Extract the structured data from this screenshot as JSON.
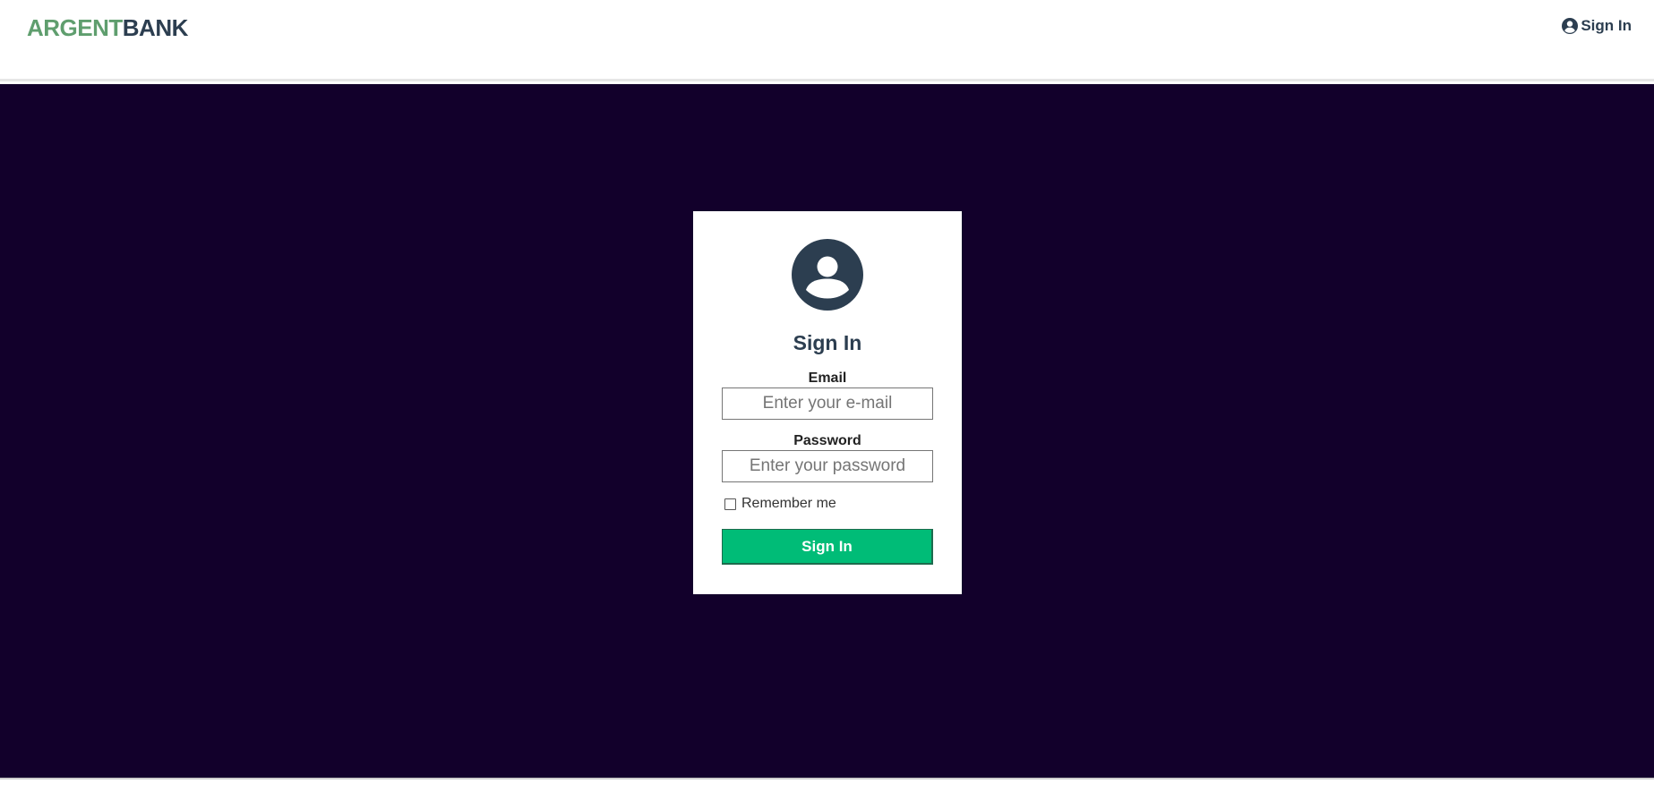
{
  "header": {
    "logo_part1": "ARGENT",
    "logo_part2": "BANK",
    "nav_signin_label": "Sign In",
    "nav_icon": "user-circle-icon"
  },
  "signin_card": {
    "avatar_icon": "user-circle-icon",
    "title": "Sign In",
    "email_label": "Email",
    "email_placeholder": "Enter your e-mail",
    "email_value": "",
    "password_label": "Password",
    "password_placeholder": "Enter your password",
    "password_value": "",
    "remember_label": "Remember me",
    "remember_checked": false,
    "submit_label": "Sign In"
  },
  "colors": {
    "brand_green": "#5f9e6e",
    "brand_dark": "#2c3e50",
    "main_background": "#12002b",
    "button_green": "#00bc77"
  }
}
